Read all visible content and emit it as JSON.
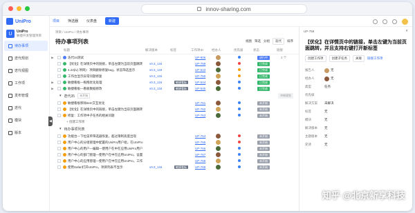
{
  "browser": {
    "url": "innov-sharing.com"
  },
  "app": {
    "logo": "UniPro"
  },
  "project": {
    "icon": "U",
    "name": "UniPro",
    "subtitle": "敏捷开发管理项目"
  },
  "sidebar": {
    "items": [
      {
        "label": "待办事项",
        "active": true
      },
      {
        "label": "迭代规划"
      },
      {
        "label": "迭代视图"
      },
      {
        "label": "工作项"
      },
      {
        "label": "发布管理"
      },
      {
        "label": "迭代"
      },
      {
        "label": "模块"
      },
      {
        "label": "版本"
      }
    ]
  },
  "topnav": {
    "tabs": [
      "项目",
      "筛选器",
      "仪表盘"
    ],
    "new_button": "新建"
  },
  "main": {
    "breadcrumb": "项目 / UniPro / 待办事项",
    "title": "待办事项列表",
    "tools": {
      "view": "视图",
      "filter": "筛选",
      "group_label": "分组",
      "group_value": "迭代",
      "sort_label": "排序"
    },
    "columns": [
      "标题",
      "解决版本",
      "标签",
      "工作项ID",
      "经办人",
      "优先级",
      "状态",
      "链接"
    ],
    "sections": [
      {
        "kind": "rows",
        "rows": [
          {
            "exp": "▶",
            "title": "迭代34测试",
            "version": "",
            "tag": "",
            "id": "UP-906",
            "av": "#c69a62",
            "pri": "#3b82f6",
            "status": "进行中",
            "stcolor": "#4f7cf7",
            "link": "3 个"
          },
          {
            "exp": "",
            "title": "【优化】在详情页中的链接，单击左键为当前页面跳转",
            "version": "v0.3_134",
            "tag": "",
            "id": "UP-759",
            "av": "#8b5a3c",
            "pri": "#ef4444",
            "status": "已完成",
            "stcolor": "#35b86b",
            "link": ""
          },
          {
            "exp": "",
            "title": "4.24(iv) 项目)：项目删除修复bug，状态筛选显示",
            "version": "v0.3_134",
            "tag": "",
            "id": "UP-543",
            "av": "#4b6b3a",
            "pri": "#f59e0b",
            "status": "已完成",
            "stcolor": "#35b86b",
            "link": ""
          },
          {
            "exp": "",
            "title": "工作台显示异常问题修复",
            "version": "v0.3_134",
            "tag": "",
            "id": "UP-760",
            "av": "#d0a458",
            "pri": "#f59e0b",
            "status": "已完成",
            "stcolor": "#35b86b",
            "link": ""
          },
          {
            "exp": "▶",
            "title": "敏捷看板—拖拽优化处理",
            "version": "v0.3_134",
            "tag": "敏捷看板",
            "id": "UP-544",
            "av": "#8b5a3c",
            "pri": "#3b82f6",
            "status": "已完成",
            "stcolor": "#35b86b",
            "link": ""
          },
          {
            "exp": "▶",
            "title": "敏捷看板—看板数据修改",
            "version": "v0.3_134",
            "tag": "敏捷看板",
            "id": "UP-545",
            "av": "#4b6b3a",
            "pri": "#3b82f6",
            "status": "已完成",
            "stcolor": "#35b86b",
            "link": ""
          }
        ]
      },
      {
        "kind": "group",
        "label": "迭代35",
        "badge": "未开始",
        "right": "冲刺规划"
      },
      {
        "kind": "rows",
        "rows": [
          {
            "exp": "",
            "title": "敏捷看板移除item交互优化",
            "version": "",
            "tag": "",
            "id": "UP-761",
            "av": "#8b5a3c",
            "pri": "#3b82f6",
            "status": "未开始",
            "stcolor": "#9aa1ad",
            "link": ""
          },
          {
            "exp": "",
            "title": "【优化】在详情页中的链接，单击左键为当前页面跳转",
            "version": "",
            "tag": "",
            "id": "UP-762",
            "av": "#d0a458",
            "pri": "#3b82f6",
            "status": "未开始",
            "stcolor": "#9aa1ad",
            "link": ""
          },
          {
            "exp": "",
            "title": "修复：工作项中子任务的相关问题",
            "version": "",
            "tag": "",
            "id": "UP-763",
            "av": "#4b6b3a",
            "pri": "#3b82f6",
            "status": "未开始",
            "stcolor": "#9aa1ad",
            "link": ""
          }
        ]
      },
      {
        "kind": "add",
        "label": "+ 创建工作项"
      },
      {
        "kind": "group",
        "label": "待办事项列表",
        "badge": "",
        "right": ""
      },
      {
        "kind": "rows",
        "rows": [
          {
            "exp": "",
            "title": "功能台—下拉菜单筛选器恢复，超过限制高度出现",
            "version": "",
            "tag": "",
            "id": "UP-764",
            "av": "#8b5a3c",
            "pri": "#ef4444",
            "status": "未开始",
            "stcolor": "#9aa1ad",
            "link": ""
          },
          {
            "exp": "",
            "title": "用户中心的分组管理中配置的UniPro用户组，在UniPro",
            "version": "",
            "tag": "",
            "id": "UP-765",
            "av": "#d0a458",
            "pri": "#ef4444",
            "status": "未开始",
            "stcolor": "#9aa1ad",
            "link": ""
          },
          {
            "exp": "",
            "title": "用户中心的用户—编辑—使用户在中在应用UniPro用户",
            "version": "",
            "tag": "",
            "id": "UP-766",
            "av": "#4b6b3a",
            "pri": "#3b82f6",
            "status": "未开始",
            "stcolor": "#9aa1ad",
            "link": ""
          },
          {
            "exp": "",
            "title": "用户中心的部门管理—使用户在中在应用UniPro，设置",
            "version": "",
            "tag": "",
            "id": "UP-767",
            "av": "#8b5a3c",
            "pri": "#3b82f6",
            "status": "未开始",
            "stcolor": "#9aa1ad",
            "link": ""
          },
          {
            "exp": "",
            "title": "用户中心的应用管理—使用户在中在应用UniPro，工作",
            "version": "",
            "tag": "",
            "id": "UP-768",
            "av": "#d0a458",
            "pri": "#3b82f6",
            "status": "未开始",
            "stcolor": "#9aa1ad",
            "link": ""
          },
          {
            "exp": "",
            "title": "使用Safari打开UniPro，项目列表不显示",
            "version": "v0.3_134",
            "tag": "敏捷看板",
            "id": "UP-769",
            "av": "#4b6b3a",
            "pri": "#3b82f6",
            "status": "未开始",
            "stcolor": "#9aa1ad",
            "link": ""
          }
        ]
      }
    ]
  },
  "panel": {
    "id": "UP-759",
    "title": "【优化】在详情页中的链接，单击左键为当前页面跳转，并且支持右键打开新标签",
    "actions": {
      "btn1": "创建工作项",
      "btn2": "创建子任务",
      "btn3": "关联",
      "link": "链接工作项"
    },
    "fields": [
      {
        "label": "报告人",
        "value": "无",
        "avatar": "#c69a62"
      },
      {
        "label": "经办人",
        "value": "无",
        "avatar": "#8b5a3c"
      },
      {
        "label": "类型",
        "value": "任务",
        "avatar": ""
      },
      {
        "label": "优先级",
        "value": "",
        "avatar": ""
      },
      {
        "label": "解决方案",
        "value": "未解决",
        "avatar": ""
      },
      {
        "label": "标签",
        "value": "无",
        "avatar": ""
      },
      {
        "label": "模块",
        "value": "无",
        "avatar": ""
      },
      {
        "label": "解决版本",
        "value": "无",
        "avatar": ""
      },
      {
        "label": "主题版本",
        "value": "无",
        "avatar": ""
      },
      {
        "label": "史诗",
        "value": "无",
        "avatar": ""
      }
    ]
  },
  "watermark": "知乎 @北京新享科技"
}
